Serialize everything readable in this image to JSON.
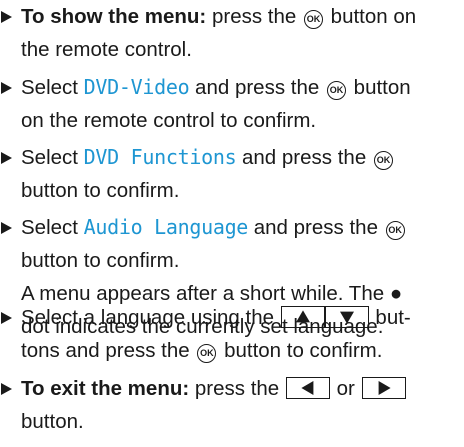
{
  "ok_label": "OK",
  "accent_color": "#1e96d2",
  "icons": {
    "bullet": "arrow-bullet-icon",
    "ok": "ok-button-icon",
    "up": "up-arrow-key-icon",
    "down": "down-arrow-key-icon",
    "left": "left-arrow-key-icon",
    "right": "right-arrow-key-icon"
  },
  "steps": [
    {
      "bold": "To show the menu:",
      "t1": " press the ",
      "t2": " button on",
      "l2": "the remote control."
    },
    {
      "t1": "Select ",
      "term": "DVD-Video",
      "t2": " and press the ",
      "t3": " button",
      "l2": "on the remote control to confirm."
    },
    {
      "t1": "Select ",
      "term": "DVD Functions",
      "t2": " and press the ",
      "l2": "button to confirm."
    },
    {
      "t1": "Select ",
      "term": "Audio Language",
      "t2": " and press the ",
      "l2": "button to confirm.",
      "l3": "A menu appears after a short while. The ●",
      "l4": "dot indicates the currently set language."
    },
    {
      "t1": "Select a language using the ",
      "t2": " but-",
      "l2a": "tons and press the ",
      "l2b": " button to confirm."
    },
    {
      "bold": "To exit the menu:",
      "t1": " press the ",
      "t2": " or ",
      "l2": "button."
    }
  ]
}
